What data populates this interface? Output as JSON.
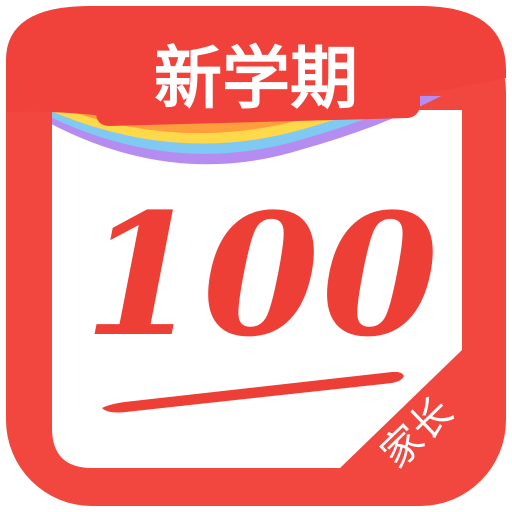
{
  "app_icon": {
    "banner_text": "新学期",
    "score_text": "100",
    "corner_label": "家长",
    "colors": {
      "frame_red": "#F2473F",
      "banner_red": "#F0423A",
      "card_white": "#FFFFFF",
      "banner_text": "#FFFFFF",
      "score_red": "#EE3F36",
      "ribbon_pink": "#F46BA8",
      "ribbon_yellow": "#FFD94A",
      "ribbon_orange": "#FF9E3D",
      "ribbon_purple": "#B58CF0",
      "ribbon_blue": "#7FC9F2"
    }
  }
}
